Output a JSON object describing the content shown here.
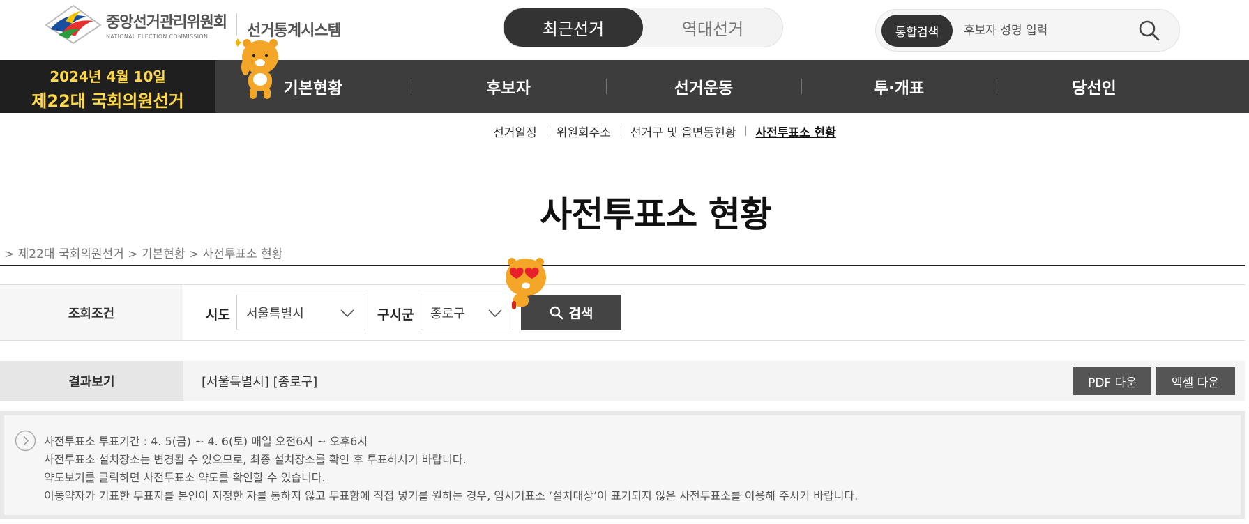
{
  "header": {
    "org_name_ko": "중앙선거관리위원회",
    "org_name_en": "NATIONAL ELECTION COMMISSION",
    "system_name": "선거통계시스템",
    "toggle": {
      "recent": "최근선거",
      "past": "역대선거"
    },
    "search": {
      "badge": "통합검색",
      "placeholder": "후보자 성명 입력"
    }
  },
  "nav": {
    "election_date": "2024년 4월 10일",
    "election_name": "제22대 국회의원선거",
    "items": [
      {
        "label": "기본현황"
      },
      {
        "label": "후보자"
      },
      {
        "label": "선거운동"
      },
      {
        "label": "투·개표"
      },
      {
        "label": "당선인"
      }
    ]
  },
  "submenu": {
    "items": [
      {
        "label": "선거일정"
      },
      {
        "label": "위원회주소"
      },
      {
        "label": "선거구 및 읍면동현황"
      },
      {
        "label": "사전투표소 현황"
      }
    ],
    "active_index": 3
  },
  "page": {
    "title": "사전투표소 현황",
    "breadcrumb": "> 제22대 국회의원선거  > 기본현황  > 사전투표소 현황"
  },
  "query": {
    "label": "조회조건",
    "sido_label": "시도",
    "sido_value": "서울특별시",
    "gu_label": "구시군",
    "gu_value": "종로구",
    "search_button": "검색"
  },
  "result": {
    "label": "결과보기",
    "text": "[서울특별시] [종로구]",
    "pdf_button": "PDF 다운",
    "excel_button": "엑셀 다운"
  },
  "notice": {
    "lines": [
      "사전투표소 투표기간 : 4. 5(금) ~ 4. 6(토) 매일 오전6시 ~ 오후6시",
      "사전투표소 설치장소는 변경될 수 있으므로, 최종 설치장소를 확인 후 투표하시기 바랍니다.",
      "약도보기를 클릭하면 사전투표소 약도를 확인할 수 있습니다.",
      "이동약자가 기표한 투표지를 본인이 지정한 자를 통하지 않고 투표함에 직접 넣기를 원하는 경우, 임시기표소 ‘설치대상’이 표기되지 않은 사전투표소를 이용해 주시기 바랍니다."
    ]
  },
  "colors": {
    "nav_bg": "#3d3d3d",
    "election_badge_bg": "#1f1f1f",
    "election_text": "#ffd94a",
    "button_dark": "#444444"
  }
}
